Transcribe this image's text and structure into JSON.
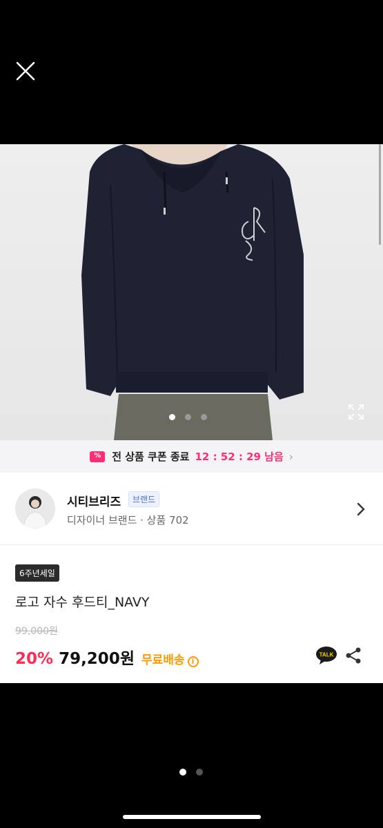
{
  "viewer": {
    "close_icon": "close-icon"
  },
  "photo": {
    "alt": "navy hoodie product photo",
    "slide_count": 3,
    "active_slide": 1,
    "expand_icon": "fullscreen-icon"
  },
  "coupon_bar": {
    "text": "전 상품 쿠폰 종료",
    "timer": "12 : 52 : 29 남음",
    "icon": "coupon-icon",
    "arrow": "›"
  },
  "seller": {
    "name": "시티브리즈",
    "badge": "브랜드",
    "subtitle": "디자이너 브랜드 · 상품 702"
  },
  "product": {
    "tag": "6주년세일",
    "title": "로고 자수 후드티_NAVY",
    "original_price": "99,000원",
    "discount": "20%",
    "price": "79,200원",
    "shipping": "무료배송",
    "info": "i",
    "talk_label": "TALK"
  },
  "pager": {
    "count": 2,
    "active": 1
  },
  "colors": {
    "accent": "#ff2d73",
    "sale": "#ff2d55",
    "shipping": "#ff9900",
    "badge": "#4a6bd6"
  }
}
